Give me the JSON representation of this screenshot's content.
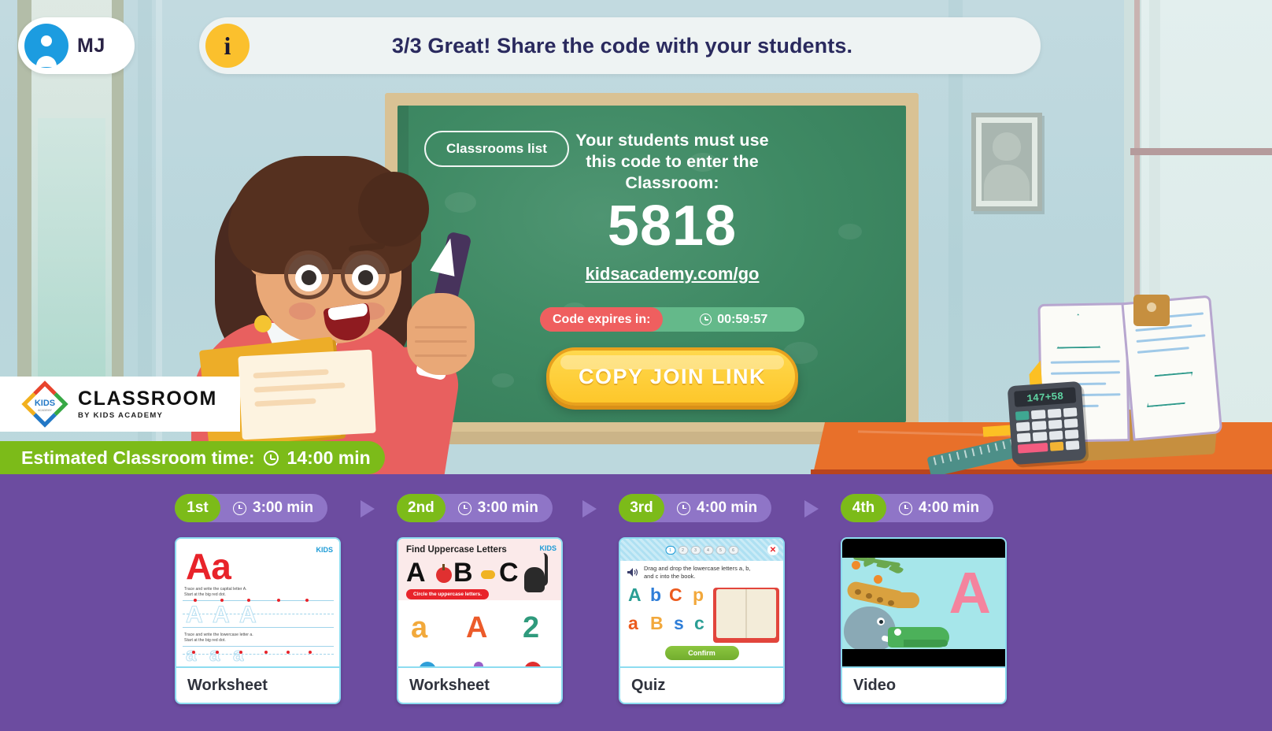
{
  "topbar": {
    "profile": {
      "initials": "MJ",
      "avatar_icon": "user-icon"
    },
    "banner": {
      "info_icon": "i",
      "message": "3/3 Great! Share the code with your students."
    }
  },
  "scene": {
    "board": {
      "classrooms_list_label": "Classrooms list",
      "instruction": "Your students must use this code to enter the Classroom:",
      "code": "5818",
      "go_link": "kidsacademy.com/go",
      "expire_label": "Code expires in:",
      "expire_time": "00:59:57",
      "clock_icon": "clock-icon",
      "copy_button_label": "COPY JOIN LINK"
    },
    "desk": {
      "calculator_display": "147+58"
    }
  },
  "logo": {
    "title": "CLASSROOM",
    "subtitle": "BY KIDS ACADEMY",
    "mark": "kids-academy-diamond-logo"
  },
  "estimated": {
    "label": "Estimated Classroom time:",
    "clock_icon": "clock-icon",
    "value": "14:00 min"
  },
  "lessons": {
    "steps": [
      {
        "ordinal": "1st",
        "duration": "3:00 min",
        "type": "Worksheet",
        "thumb": {
          "kind": "worksheet-trace",
          "heading": "Aa",
          "brand": "KIDS",
          "line1": "Trace and write the capital letter A.",
          "line2": "Start at the big red dot.",
          "line3": "Trace and write the lowercase letter a.",
          "line4": "Start at the big red dot."
        }
      },
      {
        "ordinal": "2nd",
        "duration": "3:00 min",
        "type": "Worksheet",
        "thumb": {
          "kind": "worksheet-find",
          "title": "Find Uppercase Letters",
          "brand": "KIDS",
          "letters": [
            "A",
            "B",
            "C"
          ],
          "instruction": "Circle the uppercase letters.",
          "choices": [
            "a",
            "A",
            "2"
          ]
        }
      },
      {
        "ordinal": "3rd",
        "duration": "4:00 min",
        "type": "Quiz",
        "thumb": {
          "kind": "quiz",
          "progress": [
            "1",
            "2",
            "3",
            "4",
            "5",
            "6"
          ],
          "progress_current": 1,
          "close_icon": "close-icon",
          "speaker_icon": "speaker-icon",
          "instruction": "Drag and drop the lowercase letters a, b, and c into the book.",
          "tiles_row1": [
            "A",
            "b",
            "C",
            "p"
          ],
          "tiles_row2": [
            "a",
            "B",
            "s",
            "c"
          ],
          "confirm_label": "Confirm"
        }
      },
      {
        "ordinal": "4th",
        "duration": "4:00 min",
        "type": "Video",
        "thumb": {
          "kind": "video",
          "letter": "A",
          "animals": [
            "giraffe",
            "elephant",
            "crocodile"
          ]
        }
      }
    ]
  },
  "colors": {
    "purple_panel": "#6c4ca0",
    "green_bar": "#7cbb19",
    "board_green": "#3f8a64",
    "yellow_button": "#fdc72b",
    "red_pill": "#ef5f5f",
    "avatar_blue": "#1c9ce0",
    "info_yellow": "#fbc02d",
    "card_border": "#8ddcf0"
  }
}
